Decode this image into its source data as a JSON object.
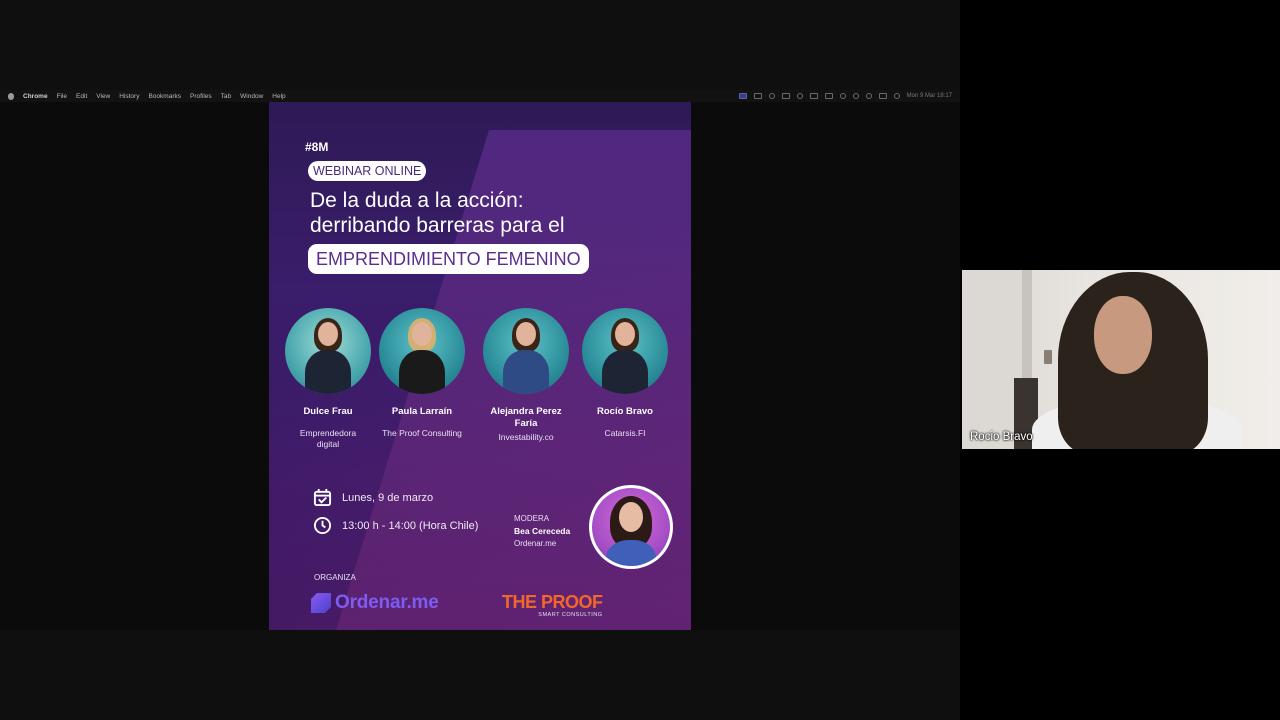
{
  "menubar": {
    "items": [
      "Chrome",
      "File",
      "Edit",
      "View",
      "History",
      "Bookmarks",
      "Profiles",
      "Tab",
      "Window",
      "Help"
    ],
    "clock": "Mon 9 Mar  18:17"
  },
  "poster": {
    "hashtag": "#8M",
    "tag": "WEBINAR ONLINE",
    "headline_line1": "De la duda a la acción:",
    "headline_line2": "derribando barreras para el",
    "highlight": "EMPRENDIMIENTO FEMENINO",
    "speakers": [
      {
        "name": "Dulce Frau",
        "org": "Emprendedora digital"
      },
      {
        "name": "Paula Larraín",
        "org": "The Proof Consulting"
      },
      {
        "name": "Alejandra Perez Faría",
        "org": "Investability.co"
      },
      {
        "name": "Rocío Bravo",
        "org": "Catarsis.FI"
      }
    ],
    "date": "Lunes, 9 de marzo",
    "time": "13:00 h - 14:00 (Hora Chile)",
    "moderator": {
      "label": "MODERA",
      "name": "Bea Cereceda",
      "org": "Ordenar.me"
    },
    "organiza_label": "ORGANIZA",
    "logo_ordenar": "Ordenar.me",
    "logo_proof": "THE PROOF",
    "logo_proof_sub": "SMART CONSULTING"
  },
  "webcam": {
    "participant_name": "Rocio Bravo"
  },
  "colors": {
    "poster_bg": "#3a1d6b",
    "accent_purple": "#5b2d8e",
    "proof_orange": "#f0672a",
    "ordenar_purple": "#7d5cf0"
  }
}
